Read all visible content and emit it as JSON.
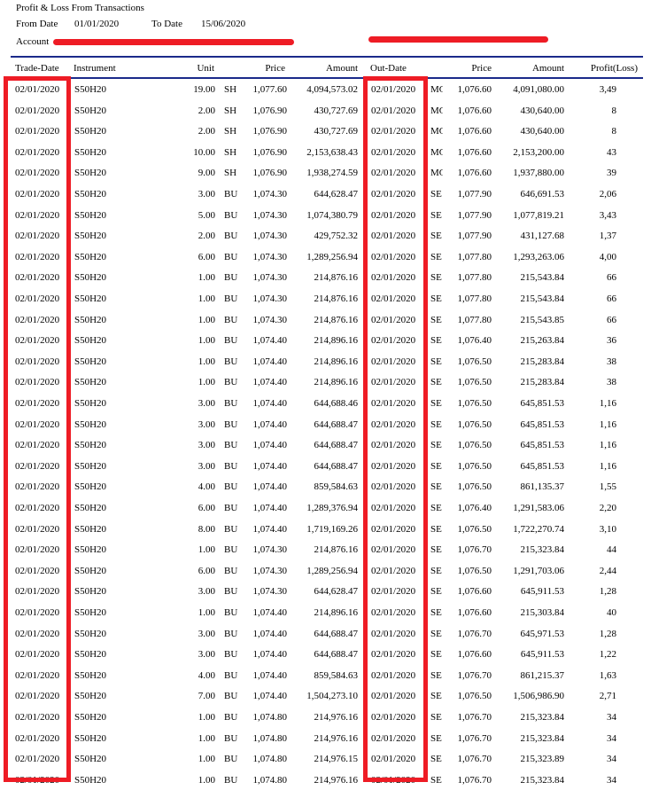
{
  "report": {
    "title": "Profit & Loss From Transactions",
    "from_date_label": "From Date",
    "from_date": "01/01/2020",
    "to_date_label": "To Date",
    "to_date": "15/06/2020",
    "account_label": "Account"
  },
  "colors": {
    "rule": "#1b2a8a",
    "highlight": "#ee1c25"
  },
  "columns": {
    "trade_date": "Trade-Date",
    "instrument": "Instrument",
    "unit": "Unit",
    "price": "Price",
    "amount": "Amount",
    "out_date": "Out-Date",
    "out_price": "Price",
    "out_amount": "Amount",
    "profit": "Profit(Loss)"
  },
  "rows": [
    {
      "td": "02/01/2020",
      "ins": "S50H20",
      "unit": "19.00",
      "side": "SH",
      "price": "1,077.60",
      "amt": "4,094,573.02",
      "od": "02/01/2020",
      "oside": "MC",
      "oprice": "1,076.60",
      "oamt": "4,091,080.00",
      "pl": "3,49"
    },
    {
      "td": "02/01/2020",
      "ins": "S50H20",
      "unit": "2.00",
      "side": "SH",
      "price": "1,076.90",
      "amt": "430,727.69",
      "od": "02/01/2020",
      "oside": "MC",
      "oprice": "1,076.60",
      "oamt": "430,640.00",
      "pl": "8"
    },
    {
      "td": "02/01/2020",
      "ins": "S50H20",
      "unit": "2.00",
      "side": "SH",
      "price": "1,076.90",
      "amt": "430,727.69",
      "od": "02/01/2020",
      "oside": "MC",
      "oprice": "1,076.60",
      "oamt": "430,640.00",
      "pl": "8"
    },
    {
      "td": "02/01/2020",
      "ins": "S50H20",
      "unit": "10.00",
      "side": "SH",
      "price": "1,076.90",
      "amt": "2,153,638.43",
      "od": "02/01/2020",
      "oside": "MC",
      "oprice": "1,076.60",
      "oamt": "2,153,200.00",
      "pl": "43"
    },
    {
      "td": "02/01/2020",
      "ins": "S50H20",
      "unit": "9.00",
      "side": "SH",
      "price": "1,076.90",
      "amt": "1,938,274.59",
      "od": "02/01/2020",
      "oside": "MC",
      "oprice": "1,076.60",
      "oamt": "1,937,880.00",
      "pl": "39"
    },
    {
      "td": "02/01/2020",
      "ins": "S50H20",
      "unit": "3.00",
      "side": "BU",
      "price": "1,074.30",
      "amt": "644,628.47",
      "od": "02/01/2020",
      "oside": "SE",
      "oprice": "1,077.90",
      "oamt": "646,691.53",
      "pl": "2,06"
    },
    {
      "td": "02/01/2020",
      "ins": "S50H20",
      "unit": "5.00",
      "side": "BU",
      "price": "1,074.30",
      "amt": "1,074,380.79",
      "od": "02/01/2020",
      "oside": "SE",
      "oprice": "1,077.90",
      "oamt": "1,077,819.21",
      "pl": "3,43"
    },
    {
      "td": "02/01/2020",
      "ins": "S50H20",
      "unit": "2.00",
      "side": "BU",
      "price": "1,074.30",
      "amt": "429,752.32",
      "od": "02/01/2020",
      "oside": "SE",
      "oprice": "1,077.90",
      "oamt": "431,127.68",
      "pl": "1,37"
    },
    {
      "td": "02/01/2020",
      "ins": "S50H20",
      "unit": "6.00",
      "side": "BU",
      "price": "1,074.30",
      "amt": "1,289,256.94",
      "od": "02/01/2020",
      "oside": "SE",
      "oprice": "1,077.80",
      "oamt": "1,293,263.06",
      "pl": "4,00"
    },
    {
      "td": "02/01/2020",
      "ins": "S50H20",
      "unit": "1.00",
      "side": "BU",
      "price": "1,074.30",
      "amt": "214,876.16",
      "od": "02/01/2020",
      "oside": "SE",
      "oprice": "1,077.80",
      "oamt": "215,543.84",
      "pl": "66"
    },
    {
      "td": "02/01/2020",
      "ins": "S50H20",
      "unit": "1.00",
      "side": "BU",
      "price": "1,074.30",
      "amt": "214,876.16",
      "od": "02/01/2020",
      "oside": "SE",
      "oprice": "1,077.80",
      "oamt": "215,543.84",
      "pl": "66"
    },
    {
      "td": "02/01/2020",
      "ins": "S50H20",
      "unit": "1.00",
      "side": "BU",
      "price": "1,074.30",
      "amt": "214,876.16",
      "od": "02/01/2020",
      "oside": "SE",
      "oprice": "1,077.80",
      "oamt": "215,543.85",
      "pl": "66"
    },
    {
      "td": "02/01/2020",
      "ins": "S50H20",
      "unit": "1.00",
      "side": "BU",
      "price": "1,074.40",
      "amt": "214,896.16",
      "od": "02/01/2020",
      "oside": "SE",
      "oprice": "1,076.40",
      "oamt": "215,263.84",
      "pl": "36"
    },
    {
      "td": "02/01/2020",
      "ins": "S50H20",
      "unit": "1.00",
      "side": "BU",
      "price": "1,074.40",
      "amt": "214,896.16",
      "od": "02/01/2020",
      "oside": "SE",
      "oprice": "1,076.50",
      "oamt": "215,283.84",
      "pl": "38"
    },
    {
      "td": "02/01/2020",
      "ins": "S50H20",
      "unit": "1.00",
      "side": "BU",
      "price": "1,074.40",
      "amt": "214,896.16",
      "od": "02/01/2020",
      "oside": "SE",
      "oprice": "1,076.50",
      "oamt": "215,283.84",
      "pl": "38"
    },
    {
      "td": "02/01/2020",
      "ins": "S50H20",
      "unit": "3.00",
      "side": "BU",
      "price": "1,074.40",
      "amt": "644,688.46",
      "od": "02/01/2020",
      "oside": "SE",
      "oprice": "1,076.50",
      "oamt": "645,851.53",
      "pl": "1,16"
    },
    {
      "td": "02/01/2020",
      "ins": "S50H20",
      "unit": "3.00",
      "side": "BU",
      "price": "1,074.40",
      "amt": "644,688.47",
      "od": "02/01/2020",
      "oside": "SE",
      "oprice": "1,076.50",
      "oamt": "645,851.53",
      "pl": "1,16"
    },
    {
      "td": "02/01/2020",
      "ins": "S50H20",
      "unit": "3.00",
      "side": "BU",
      "price": "1,074.40",
      "amt": "644,688.47",
      "od": "02/01/2020",
      "oside": "SE",
      "oprice": "1,076.50",
      "oamt": "645,851.53",
      "pl": "1,16"
    },
    {
      "td": "02/01/2020",
      "ins": "S50H20",
      "unit": "3.00",
      "side": "BU",
      "price": "1,074.40",
      "amt": "644,688.47",
      "od": "02/01/2020",
      "oside": "SE",
      "oprice": "1,076.50",
      "oamt": "645,851.53",
      "pl": "1,16"
    },
    {
      "td": "02/01/2020",
      "ins": "S50H20",
      "unit": "4.00",
      "side": "BU",
      "price": "1,074.40",
      "amt": "859,584.63",
      "od": "02/01/2020",
      "oside": "SE",
      "oprice": "1,076.50",
      "oamt": "861,135.37",
      "pl": "1,55"
    },
    {
      "td": "02/01/2020",
      "ins": "S50H20",
      "unit": "6.00",
      "side": "BU",
      "price": "1,074.40",
      "amt": "1,289,376.94",
      "od": "02/01/2020",
      "oside": "SE",
      "oprice": "1,076.40",
      "oamt": "1,291,583.06",
      "pl": "2,20"
    },
    {
      "td": "02/01/2020",
      "ins": "S50H20",
      "unit": "8.00",
      "side": "BU",
      "price": "1,074.40",
      "amt": "1,719,169.26",
      "od": "02/01/2020",
      "oside": "SE",
      "oprice": "1,076.50",
      "oamt": "1,722,270.74",
      "pl": "3,10"
    },
    {
      "td": "02/01/2020",
      "ins": "S50H20",
      "unit": "1.00",
      "side": "BU",
      "price": "1,074.30",
      "amt": "214,876.16",
      "od": "02/01/2020",
      "oside": "SE",
      "oprice": "1,076.70",
      "oamt": "215,323.84",
      "pl": "44"
    },
    {
      "td": "02/01/2020",
      "ins": "S50H20",
      "unit": "6.00",
      "side": "BU",
      "price": "1,074.30",
      "amt": "1,289,256.94",
      "od": "02/01/2020",
      "oside": "SE",
      "oprice": "1,076.50",
      "oamt": "1,291,703.06",
      "pl": "2,44"
    },
    {
      "td": "02/01/2020",
      "ins": "S50H20",
      "unit": "3.00",
      "side": "BU",
      "price": "1,074.30",
      "amt": "644,628.47",
      "od": "02/01/2020",
      "oside": "SE",
      "oprice": "1,076.60",
      "oamt": "645,911.53",
      "pl": "1,28"
    },
    {
      "td": "02/01/2020",
      "ins": "S50H20",
      "unit": "1.00",
      "side": "BU",
      "price": "1,074.40",
      "amt": "214,896.16",
      "od": "02/01/2020",
      "oside": "SE",
      "oprice": "1,076.60",
      "oamt": "215,303.84",
      "pl": "40"
    },
    {
      "td": "02/01/2020",
      "ins": "S50H20",
      "unit": "3.00",
      "side": "BU",
      "price": "1,074.40",
      "amt": "644,688.47",
      "od": "02/01/2020",
      "oside": "SE",
      "oprice": "1,076.70",
      "oamt": "645,971.53",
      "pl": "1,28"
    },
    {
      "td": "02/01/2020",
      "ins": "S50H20",
      "unit": "3.00",
      "side": "BU",
      "price": "1,074.40",
      "amt": "644,688.47",
      "od": "02/01/2020",
      "oside": "SE",
      "oprice": "1,076.60",
      "oamt": "645,911.53",
      "pl": "1,22"
    },
    {
      "td": "02/01/2020",
      "ins": "S50H20",
      "unit": "4.00",
      "side": "BU",
      "price": "1,074.40",
      "amt": "859,584.63",
      "od": "02/01/2020",
      "oside": "SE",
      "oprice": "1,076.70",
      "oamt": "861,215.37",
      "pl": "1,63"
    },
    {
      "td": "02/01/2020",
      "ins": "S50H20",
      "unit": "7.00",
      "side": "BU",
      "price": "1,074.40",
      "amt": "1,504,273.10",
      "od": "02/01/2020",
      "oside": "SE",
      "oprice": "1,076.50",
      "oamt": "1,506,986.90",
      "pl": "2,71"
    },
    {
      "td": "02/01/2020",
      "ins": "S50H20",
      "unit": "1.00",
      "side": "BU",
      "price": "1,074.80",
      "amt": "214,976.16",
      "od": "02/01/2020",
      "oside": "SE",
      "oprice": "1,076.70",
      "oamt": "215,323.84",
      "pl": "34"
    },
    {
      "td": "02/01/2020",
      "ins": "S50H20",
      "unit": "1.00",
      "side": "BU",
      "price": "1,074.80",
      "amt": "214,976.16",
      "od": "02/01/2020",
      "oside": "SE",
      "oprice": "1,076.70",
      "oamt": "215,323.84",
      "pl": "34"
    },
    {
      "td": "02/01/2020",
      "ins": "S50H20",
      "unit": "1.00",
      "side": "BU",
      "price": "1,074.80",
      "amt": "214,976.15",
      "od": "02/01/2020",
      "oside": "SE",
      "oprice": "1,076.70",
      "oamt": "215,323.89",
      "pl": "34"
    },
    {
      "td": "02/01/2020",
      "ins": "S50H20",
      "unit": "1.00",
      "side": "BU",
      "price": "1,074.80",
      "amt": "214,976.16",
      "od": "02/01/2020",
      "oside": "SE",
      "oprice": "1,076.70",
      "oamt": "215,323.84",
      "pl": "34"
    }
  ]
}
